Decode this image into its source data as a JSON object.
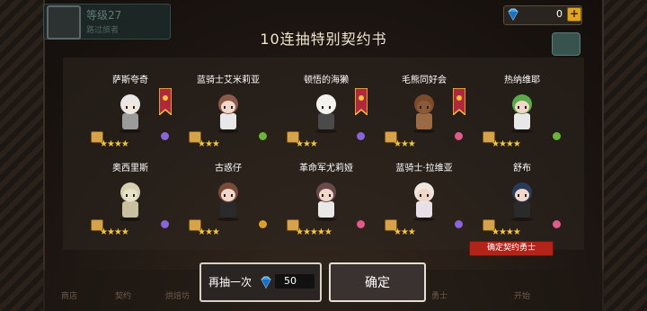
{
  "header": {
    "level_text": "等级27",
    "sub_text": "路过旅者",
    "gem_count": "0",
    "plus_label": "+"
  },
  "dialog": {
    "title": "10连抽特别契约书",
    "tag_label": "确定契约勇士"
  },
  "cards": [
    {
      "name": "萨斯夸奇",
      "stars": "★★★★",
      "elem_color": "#8a64d8",
      "banner": true,
      "skin": "#f2e6dd",
      "hair": "#e8e8e8",
      "body": "#9b9b9b"
    },
    {
      "name": "蓝骑士艾米莉亚",
      "stars": "★★★",
      "elem_color": "#6ab43a",
      "banner": false,
      "skin": "#f1d7c9",
      "hair": "#8b5a4a",
      "body": "#e8e8e8"
    },
    {
      "name": "顿悟的海獭",
      "stars": "★★★",
      "elem_color": "#8a64d8",
      "banner": true,
      "skin": "#f4f2ec",
      "hair": "#f4f2ec",
      "body": "#4a4a4a"
    },
    {
      "name": "毛熊同好会",
      "stars": "★★★",
      "elem_color": "#e05a8a",
      "banner": true,
      "skin": "#8a5a3a",
      "hair": "#7a4a2a",
      "body": "#9a6a44"
    },
    {
      "name": "热纳维耶",
      "stars": "★★★★",
      "elem_color": "#6ab43a",
      "banner": false,
      "skin": "#f1d7c9",
      "hair": "#5aaa4a",
      "body": "#e8e8e8"
    },
    {
      "name": "奥西里斯",
      "stars": "★★★★",
      "elem_color": "#8a64d8",
      "banner": false,
      "skin": "#e8e2c8",
      "hair": "#d6d0b0",
      "body": "#c8c0a0"
    },
    {
      "name": "古惑仔",
      "stars": "★★★",
      "elem_color": "#d9a030",
      "banner": false,
      "skin": "#f1d7c9",
      "hair": "#7a4a3a",
      "body": "#2a2a2a"
    },
    {
      "name": "革命军尤莉娅",
      "stars": "★★★★★",
      "elem_color": "#e05a8a",
      "banner": false,
      "skin": "#f1d7c9",
      "hair": "#6a4a48",
      "body": "#e8e8e8"
    },
    {
      "name": "蓝骑士·拉维亚",
      "stars": "★★★",
      "elem_color": "#8a64d8",
      "banner": false,
      "skin": "#f1d7c9",
      "hair": "#f0e8e0",
      "body": "#e8e0e8"
    },
    {
      "name": "舒布",
      "stars": "★★★★",
      "elem_color": "#e05a8a",
      "banner": false,
      "skin": "#f1d7c9",
      "hair": "#2a3a5a",
      "body": "#2a2a2a"
    }
  ],
  "buttons": {
    "again_label": "再抽一次",
    "again_cost": "50",
    "ok_label": "确定"
  },
  "nav": [
    "商店",
    "契约",
    "烘焙坊",
    "",
    "",
    "",
    "",
    "勇士",
    "开始"
  ],
  "colors": {
    "accent": "#e0a420",
    "tag_red": "#b2241a"
  }
}
